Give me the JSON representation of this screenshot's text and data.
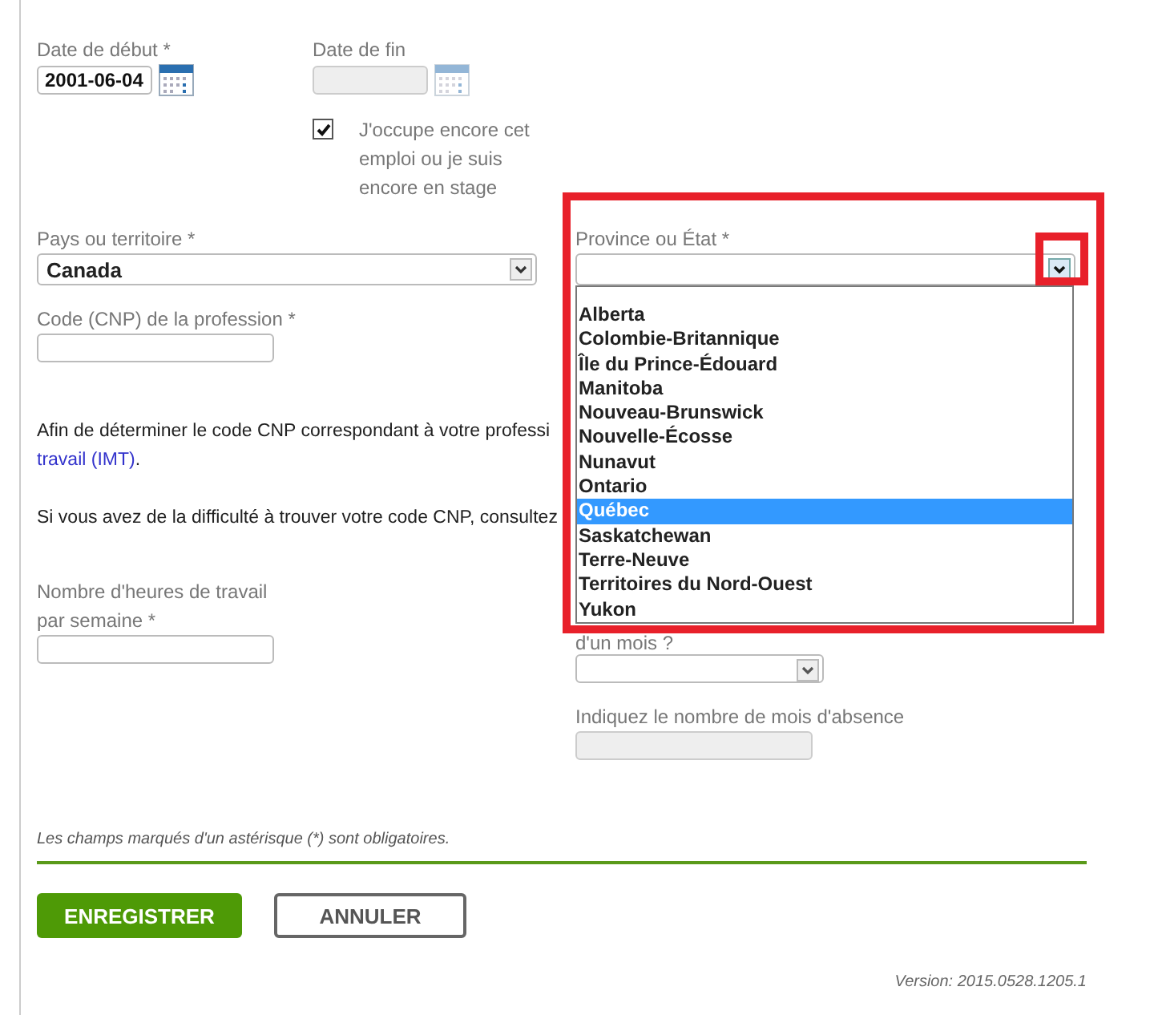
{
  "start_date": {
    "label": "Date de début *",
    "value": "2001-06-04"
  },
  "end_date": {
    "label": "Date de fin",
    "disabled": true
  },
  "still_employed": {
    "label": "J'occupe encore cet emploi ou je suis encore en stage",
    "checked": true
  },
  "country": {
    "label": "Pays ou territoire *",
    "value": "Canada"
  },
  "province": {
    "label": "Province ou État *",
    "expanded": true,
    "options": [
      {
        "label": "Alberta",
        "selected": false
      },
      {
        "label": "Colombie-Britannique",
        "selected": false
      },
      {
        "label": "Île du Prince-Édouard",
        "selected": false
      },
      {
        "label": "Manitoba",
        "selected": false
      },
      {
        "label": "Nouveau-Brunswick",
        "selected": false
      },
      {
        "label": "Nouvelle-Écosse",
        "selected": false
      },
      {
        "label": "Nunavut",
        "selected": false
      },
      {
        "label": "Ontario",
        "selected": false
      },
      {
        "label": "Québec",
        "selected": true
      },
      {
        "label": "Saskatchewan",
        "selected": false
      },
      {
        "label": "Terre-Neuve",
        "selected": false
      },
      {
        "label": "Territoires du Nord-Ouest",
        "selected": false
      },
      {
        "label": "Yukon",
        "selected": false
      }
    ]
  },
  "profession_code": {
    "label": "Code (CNP) de la profession *"
  },
  "info_1": {
    "text": "Afin de déterminer le code CNP correspondant à votre professi",
    "link": "travail (IMT)",
    "after": "."
  },
  "info_2": {
    "text": "Si vous avez de la difficulté à trouver votre code CNP, consultez"
  },
  "hours": {
    "label": "Nombre d'heures de travail par semaine *"
  },
  "absence": {
    "label": "d'un mois ?"
  },
  "absence_months": {
    "label": "Indiquez le nombre de mois d'absence",
    "disabled": true
  },
  "required_note": "Les champs marqués d'un astérisque (*) sont obligatoires.",
  "buttons": {
    "save": "ENREGISTRER",
    "cancel": "ANNULER"
  },
  "version": "Version: 2015.0528.1205.1"
}
